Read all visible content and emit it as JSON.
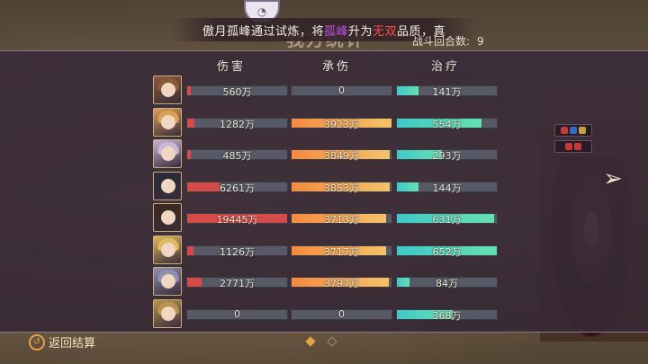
{
  "banner": {
    "part1": "傲月孤峰通过试炼，将",
    "hero_name": "孤峰",
    "part2": "升为",
    "quality": "无双",
    "part3": "品质，真"
  },
  "title": "我方统计",
  "rounds": {
    "label": "战斗回合数:",
    "value": "9"
  },
  "columns": {
    "damage": "伤害",
    "taken": "承伤",
    "heal": "治疗"
  },
  "rows": [
    {
      "damage": "560万",
      "damage_frac": 0.03,
      "taken": "0",
      "taken_frac": 0.0,
      "heal": "141万",
      "heal_frac": 0.22
    },
    {
      "damage": "1282万",
      "damage_frac": 0.07,
      "taken": "3923万",
      "taken_frac": 1.0,
      "heal": "554万",
      "heal_frac": 0.85
    },
    {
      "damage": "485万",
      "damage_frac": 0.03,
      "taken": "3849万",
      "taken_frac": 0.98,
      "heal": "293万",
      "heal_frac": 0.45
    },
    {
      "damage": "6261万",
      "damage_frac": 0.32,
      "taken": "3853万",
      "taken_frac": 0.98,
      "heal": "144万",
      "heal_frac": 0.22
    },
    {
      "damage": "19445万",
      "damage_frac": 1.0,
      "taken": "3713万",
      "taken_frac": 0.95,
      "heal": "631万",
      "heal_frac": 0.97
    },
    {
      "damage": "1126万",
      "damage_frac": 0.06,
      "taken": "3717万",
      "taken_frac": 0.95,
      "heal": "652万",
      "heal_frac": 1.0
    },
    {
      "damage": "2771万",
      "damage_frac": 0.14,
      "taken": "3797万",
      "taken_frac": 0.97,
      "heal": "84万",
      "heal_frac": 0.13
    },
    {
      "damage": "0",
      "damage_frac": 0.0,
      "taken": "0",
      "taken_frac": 0.0,
      "heal": "368万",
      "heal_frac": 0.56
    }
  ],
  "avatar_colors": [
    "#8a5a3a",
    "#d9a05a",
    "#c9b6d8",
    "#2a2a3a",
    "#3a2a22",
    "#e0b860",
    "#8f8fb0",
    "#b89450"
  ],
  "back_label": "返回结算",
  "pager": {
    "count": 2,
    "active": 0
  }
}
